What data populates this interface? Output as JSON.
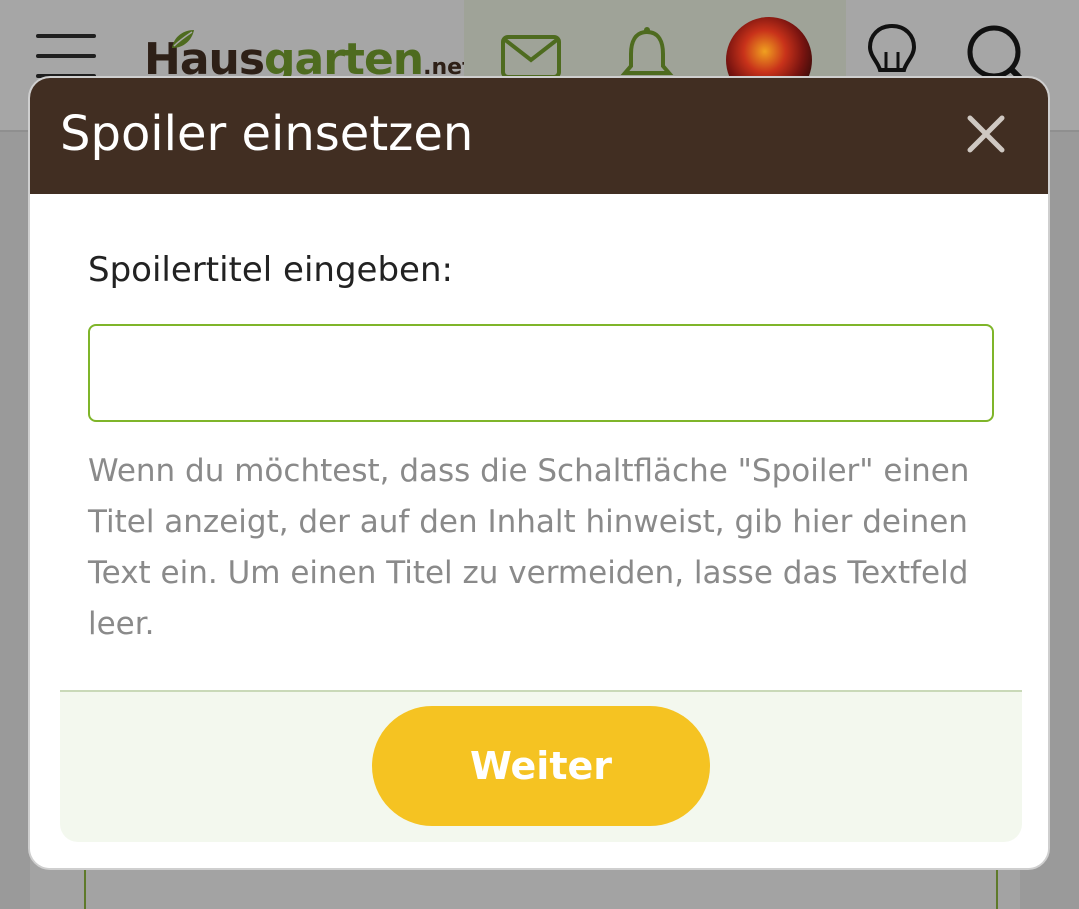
{
  "site": {
    "logo": {
      "haus": "Haus",
      "garten": "garten",
      "net": ".net"
    }
  },
  "nav": {
    "icons": [
      "menu-icon",
      "mail-icon",
      "bell-icon",
      "avatar",
      "lightbulb-icon",
      "search-icon"
    ]
  },
  "modal": {
    "title": "Spoiler einsetzen",
    "close_icon": "close-icon",
    "label": "Spoilertitel eingeben:",
    "input_value": "",
    "help_text": "Wenn du möchtest, dass die Schaltfläche \"Spoiler\" einen Titel anzeigt, der auf den Inhalt hinweist, gib hier deinen Text ein. Um einen Titel zu vermeiden, lasse das Textfeld leer.",
    "submit_label": "Weiter"
  },
  "colors": {
    "header_brown": "#412e22",
    "button_yellow": "#f5c322",
    "input_border_green": "#7fb52a",
    "footer_green": "#f3f8ee"
  }
}
